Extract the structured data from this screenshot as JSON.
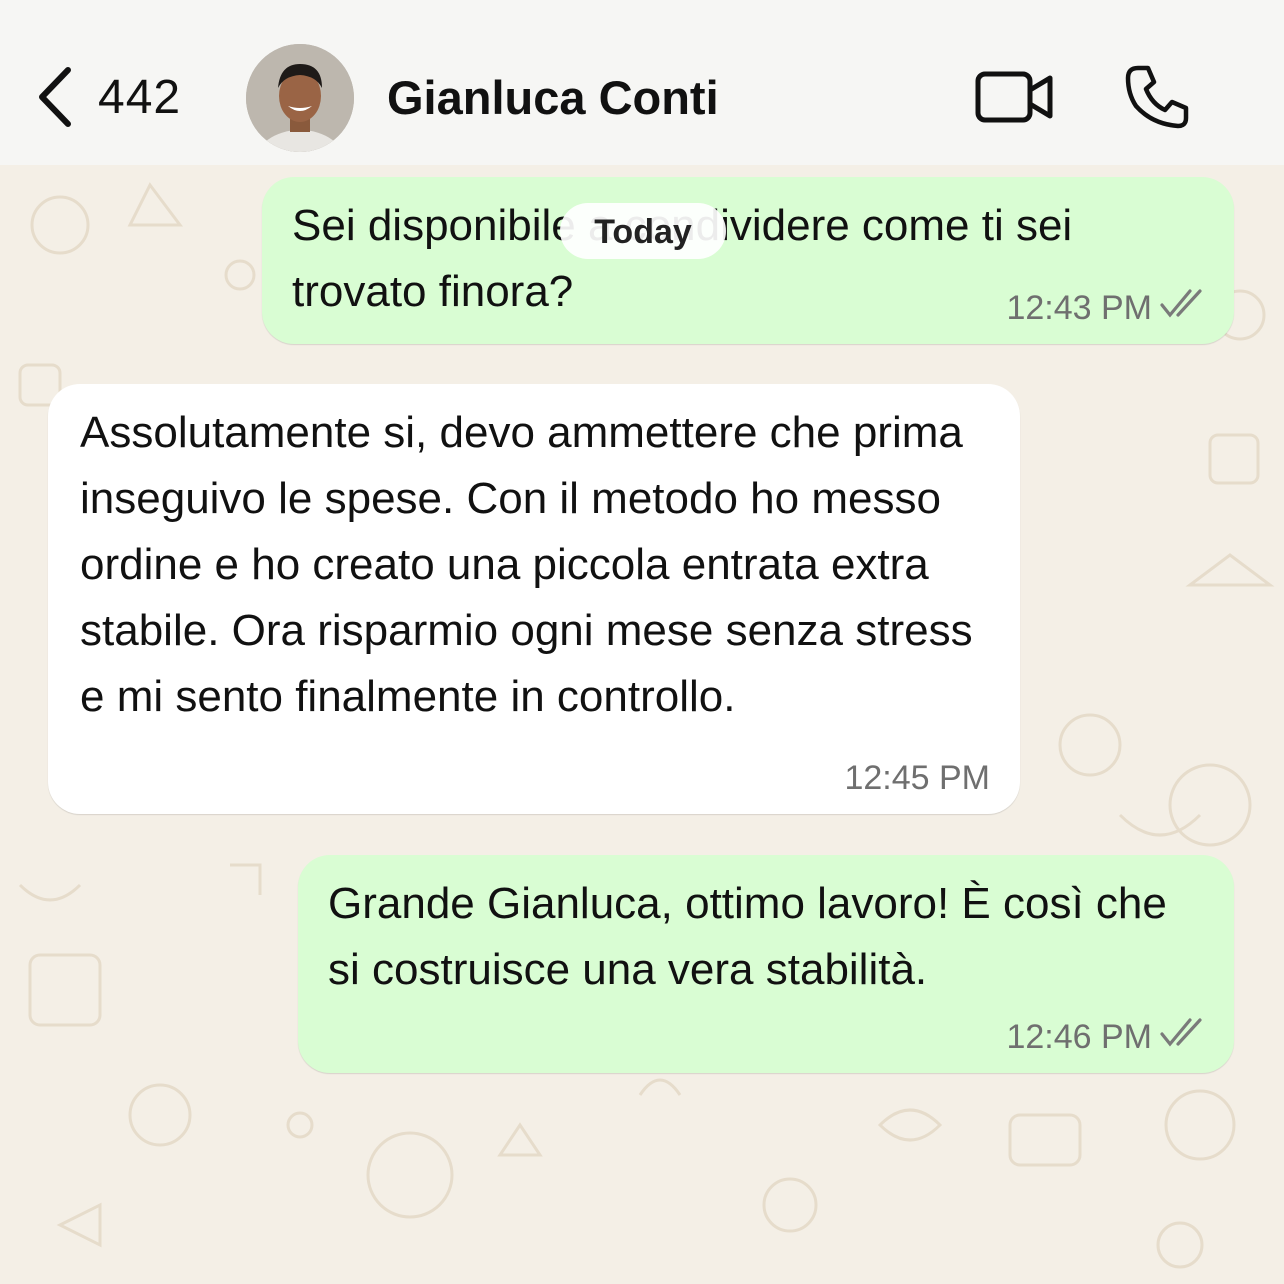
{
  "header": {
    "back_count": "442",
    "contact_name": "Gianluca Conti"
  },
  "date_separator": "Today",
  "messages": [
    {
      "direction": "outgoing",
      "text": "Sei disponibile a condividere come ti sei trovato finora?",
      "time": "12:43 PM",
      "status_icon": "double-check-icon"
    },
    {
      "direction": "incoming",
      "text": "Assolutamente si, devo ammettere che prima inseguivo le spese. Con il metodo ho messo ordine e ho creato una piccola entrata extra stabile. Ora risparmio ogni mese senza stress e mi sento finalmente in controllo.",
      "time": "12:45 PM"
    },
    {
      "direction": "outgoing",
      "text": "Grande Gianluca, ottimo lavoro! È così che si costruisce una vera stabilità.",
      "time": "12:46 PM",
      "status_icon": "double-check-icon"
    }
  ],
  "colors": {
    "outgoing_bubble": "#d9fdd3",
    "incoming_bubble": "#ffffff",
    "chat_background": "#f4efe6",
    "header_background": "#f6f6f4"
  }
}
